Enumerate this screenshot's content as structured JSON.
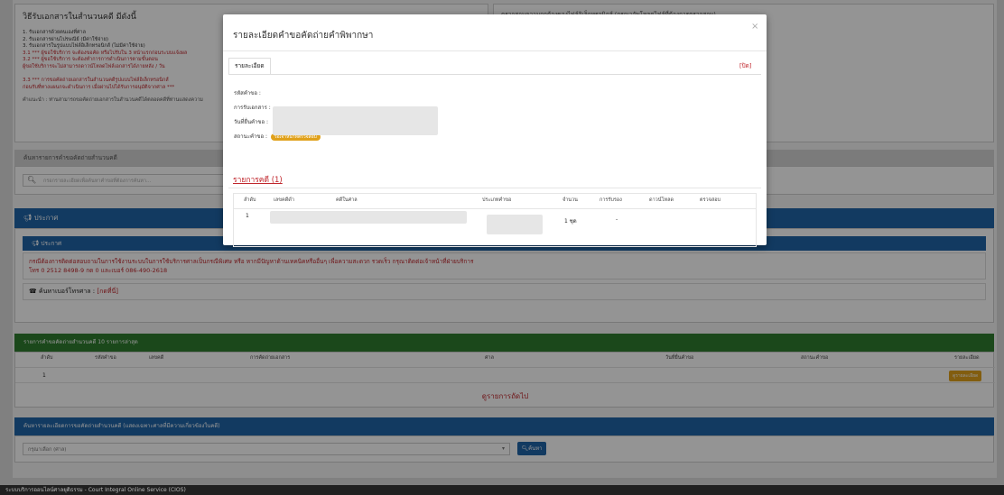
{
  "left_panel": {
    "title": "วิธีรับเอกสารในสำนวนคดี มีดังนี้",
    "lines": [
      "1. รับเอกสารด้วยตนเองที่ศาล",
      "2. รับเอกสารผ่านไปรษณีย์ (มีค่าใช้จ่าย)",
      "3. รับเอกสารในรูปแบบไฟล์อิเล็กทรอนิกส์ (ไม่มีค่าใช้จ่าย)",
      "3.1 *** ผู้ขอใช้บริการ จะต้องขอคัด หรือไปรับใน 3 หน้าแรกก่อนระบบแจ้งผล",
      "3.2 *** ผู้ขอใช้บริการ จะต้องทำการการดำเนินการตามขั้นตอน",
      "ผู้ขอใช้บริการจะไม่สามารถดาวน์โหลดไฟล์เอกสารได้ภายหลัง / วัน"
    ],
    "lines2": [
      "3.3 *** การขอคัดถ่ายเอกสารในสำนวนคดีรูปแบบไฟล์อิเล็กทรอนิกส์",
      "ก่อนรับที่ทางแผนกจะดำเนินการ เมื่อผ่านไปได้รับการอนุมัติจากศาล ***"
    ],
    "note": "คำแนะนำ : ท่านสามารถขอคัดถ่ายเอกสารในสำนวนคดีได้ตลอดคดีที่ท่านแสดงความ"
  },
  "right_panel": {
    "text": "ตรวจสอบความถูกต้องของไฟล์อิเล็กทรอนิกส์ (กรุณาอัพโหลดไฟล์ที่ต้องการตรวจสอบ)"
  },
  "search_section": {
    "header": "ค้นหารายการคำขอคัดถ่ายสำนวนคดี",
    "placeholder": "กรอกรายละเอียดเพื่อค้นหาคำขอที่ต้องการค้นหา..."
  },
  "announcement": {
    "header": "ประกาศ",
    "sub_header": "ประกาศ",
    "text_line1": "กรณีต้องการติดต่อสอบถามในการใช้งานระบบในการใช้บริการศาลเป็นกรณีพิเศษ หรือ หากมีปัญหาด้านเทคนิคหรืออื่นๆ เพื่อความสะดวก รวดเร็ว กรุณาติดต่อเจ้าหน้าที่ฝ่ายบริการ",
    "text_line2": "โทร 0 2512 8498-9 กด 0 และเบอร์ 086-490-2618",
    "phone_link_label": "ค้นหาเบอร์โทรศาล : ",
    "phone_link": "[กดที่นี่]"
  },
  "recent_table": {
    "header": "รายการคำขอคัดถ่ายสำนวนคดี 10 รายการล่าสุด",
    "columns": [
      "ลำดับ",
      "รหัสคำขอ",
      "เลขคดี",
      "การคัดถ่ายเอกสาร",
      "ศาล",
      "วันที่ยื่นคำขอ",
      "สถานะคำขอ",
      "รายละเอียด"
    ],
    "row_index": "1",
    "detail_button": "ดูรายละเอียด",
    "more_link": "ดูรายการถัดไป"
  },
  "court_search": {
    "header": "ค้นหารายละเอียดการขอคัดถ่ายสำนวนคดี (แสดงเฉพาะศาลที่มีความเกี่ยวข้องในคดี)",
    "select_value": "กรุณาเลือก (ศาล)",
    "button": "ค้นหา"
  },
  "footer": {
    "text": "ระบบบริการออนไลน์ศาลยุติธรรม - Court Integral Online Service (CIOS)"
  },
  "modal": {
    "title": "รายละเอียดคำขอคัดถ่ายคำพิพากษา",
    "close_symbol": "×",
    "tab_label": "รายละเอียด",
    "close_link": "[ปิด]",
    "fields": {
      "request_code_label": "รหัสคำขอ :",
      "receive_method_label": "การรับเอกสาร :",
      "submit_date_label": "วันที่ยื่นคำขอ :",
      "status_label": "สถานะคำขอ :",
      "status_badge": "รอเจ้าหน้าที่ตรวจสอบ"
    },
    "case_list_title": "รายการคดี (1)",
    "columns": [
      "ลำดับ",
      "เลขคดีดำ",
      "คดีในศาล",
      "ประเภทคำขอ",
      "จำนวน",
      "การรับรอง",
      "ดาวน์โหลด",
      "ตรวจสอบ"
    ],
    "row": {
      "index": "1",
      "quantity": "1 ชุด",
      "certify": "-"
    }
  },
  "colors": {
    "blue_header": "#1f64a8",
    "green_header": "#2f7d2f",
    "link_red": "#c0262c",
    "badge": "#e0a11b"
  }
}
